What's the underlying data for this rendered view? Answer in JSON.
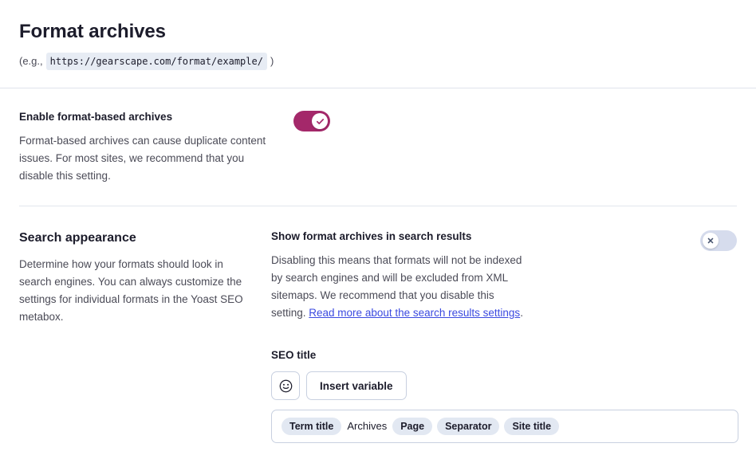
{
  "header": {
    "title": "Format archives",
    "example_prefix": "(e.g.,",
    "example_url": "https://gearscape.com/format/example/",
    "example_suffix": ")"
  },
  "enable_section": {
    "label": "Enable format-based archives",
    "description": "Format-based archives can cause duplicate content issues. For most sites, we recommend that you disable this setting.",
    "toggle": {
      "name": "enable-format-based-archives-toggle",
      "state": "on",
      "icon": "check-icon"
    }
  },
  "search_appearance": {
    "heading": "Search appearance",
    "description": "Determine how your formats should look in search engines. You can always customize the settings for individual formats in the Yoast SEO metabox.",
    "show_in_results": {
      "label": "Show format archives in search results",
      "description_before_link": "Disabling this means that formats will not be indexed by search engines and will be excluded from XML sitemaps. We recommend that you disable this setting. ",
      "link_text": "Read more about the search results settings",
      "description_after_link": ".",
      "toggle": {
        "name": "show-format-archives-in-search-results-toggle",
        "state": "off",
        "icon": "close-icon"
      }
    },
    "seo_title": {
      "label": "SEO title",
      "emoji_button_icon": "smiley-icon",
      "insert_variable_label": "Insert variable",
      "tokens": [
        {
          "text": "Term title",
          "type": "token"
        },
        {
          "text": "Archives",
          "type": "plain"
        },
        {
          "text": "Page",
          "type": "token"
        },
        {
          "text": "Separator",
          "type": "token"
        },
        {
          "text": "Site title",
          "type": "token"
        }
      ]
    }
  },
  "colors": {
    "accent_on": "#a4286a",
    "toggle_off": "#d6dced",
    "link": "#3b4ae0",
    "heading": "#1c1c2b",
    "body_text": "#4b4b57",
    "border": "#c8d0e0",
    "token_bg": "#e2e8f2",
    "code_bg": "#e7ecf4"
  }
}
